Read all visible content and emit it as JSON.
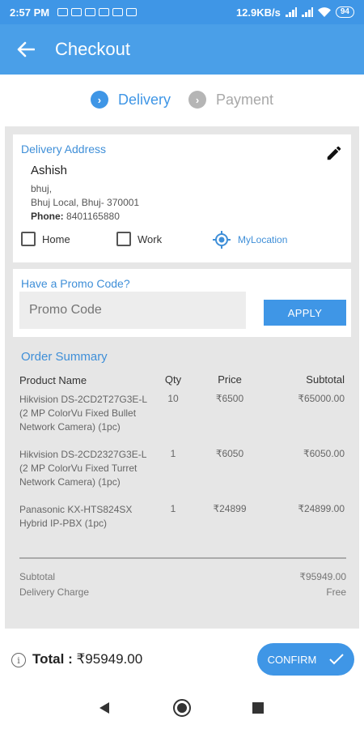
{
  "status_bar": {
    "time": "2:57 PM",
    "network_speed": "12.9KB/s",
    "battery": "94"
  },
  "app_bar": {
    "back_icon": "arrow-left-icon",
    "title": "Checkout"
  },
  "stepper": {
    "steps": [
      {
        "label": "Delivery",
        "state": "active"
      },
      {
        "label": "Payment",
        "state": "inactive"
      }
    ]
  },
  "address": {
    "title": "Delivery Address",
    "name": "Ashish",
    "line1": "bhuj,",
    "line2": "Bhuj Local, Bhuj- 370001",
    "phone_label": "Phone:",
    "phone": "8401165880",
    "options": {
      "home": "Home",
      "work": "Work",
      "location": "MyLocation"
    }
  },
  "promo": {
    "title": "Have a Promo Code?",
    "placeholder": "Promo Code",
    "apply_label": "APPLY"
  },
  "order_summary": {
    "title": "Order Summary",
    "headers": {
      "name": "Product Name",
      "qty": "Qty",
      "price": "Price",
      "subtotal": "Subtotal"
    },
    "items": [
      {
        "name": "Hikvision DS-2CD2T27G3E-L (2 MP ColorVu Fixed Bullet Network Camera) (1pc)",
        "qty": "10",
        "price": "₹6500",
        "subtotal": "₹65000.00"
      },
      {
        "name": "Hikvision DS-2CD2327G3E-L (2 MP ColorVu Fixed Turret Network Camera) (1pc)",
        "qty": "1",
        "price": "₹6050",
        "subtotal": "₹6050.00"
      },
      {
        "name": "Panasonic KX-HTS824SX Hybrid IP-PBX (1pc)",
        "qty": "1",
        "price": "₹24899",
        "subtotal": "₹24899.00"
      }
    ],
    "subtotal_label": "Subtotal",
    "subtotal_value": "₹95949.00",
    "delivery_label": "Delivery Charge",
    "delivery_value": "Free"
  },
  "footer": {
    "total_label": "Total :",
    "total_value": "₹95949.00",
    "confirm_label": "CONFIRM"
  },
  "colors": {
    "primary": "#3f96e6",
    "panel": "#e6e6e6"
  }
}
